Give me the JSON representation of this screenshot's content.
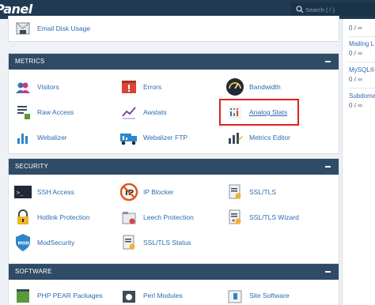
{
  "header": {
    "logo_text": "Panel",
    "search_placeholder": "Search ( / )"
  },
  "top_item": {
    "label": "Email Disk Usage",
    "icon": "email-disk-usage-icon"
  },
  "metrics": {
    "title": "METRICS",
    "items": [
      {
        "label": "Visitors",
        "icon": "visitors-icon"
      },
      {
        "label": "Errors",
        "icon": "errors-icon"
      },
      {
        "label": "Bandwidth",
        "icon": "bandwidth-icon"
      },
      {
        "label": "Raw Access",
        "icon": "raw-access-icon"
      },
      {
        "label": "Awstats",
        "icon": "awstats-icon"
      },
      {
        "label": "Analog Stats",
        "icon": "analog-stats-icon"
      },
      {
        "label": "Webalizer",
        "icon": "webalizer-icon"
      },
      {
        "label": "Webalizer FTP",
        "icon": "webalizer-ftp-icon"
      },
      {
        "label": "Metrics Editor",
        "icon": "metrics-editor-icon"
      }
    ]
  },
  "security": {
    "title": "SECURITY",
    "items": [
      {
        "label": "SSH Access",
        "icon": "ssh-access-icon"
      },
      {
        "label": "IP Blocker",
        "icon": "ip-blocker-icon"
      },
      {
        "label": "SSL/TLS",
        "icon": "ssl-tls-icon"
      },
      {
        "label": "Hotlink Protection",
        "icon": "hotlink-protection-icon"
      },
      {
        "label": "Leech Protection",
        "icon": "leech-protection-icon"
      },
      {
        "label": "SSL/TLS Wizard",
        "icon": "ssl-tls-wizard-icon"
      },
      {
        "label": "ModSecurity",
        "icon": "modsecurity-icon"
      },
      {
        "label": "SSL/TLS Status",
        "icon": "ssl-tls-status-icon"
      }
    ]
  },
  "software": {
    "title": "SOFTWARE",
    "items": [
      {
        "label": "PHP PEAR Packages",
        "icon": "php-pear-icon"
      },
      {
        "label": "Perl Modules",
        "icon": "perl-modules-icon"
      },
      {
        "label": "Site Software",
        "icon": "site-software-icon"
      }
    ]
  },
  "side_stats": {
    "items": [
      {
        "text": "0 / ∞"
      },
      {
        "text": "Mailing L"
      },
      {
        "text": "0 / ∞"
      },
      {
        "text": "MySQL®"
      },
      {
        "text": "0 / ∞"
      },
      {
        "text": "Subdoma"
      },
      {
        "text": "0 / ∞"
      }
    ]
  },
  "colors": {
    "topbar": "#1f3a53",
    "panel_header": "#2f4b66",
    "link": "#2d6bb0",
    "highlight": "#e02020"
  }
}
